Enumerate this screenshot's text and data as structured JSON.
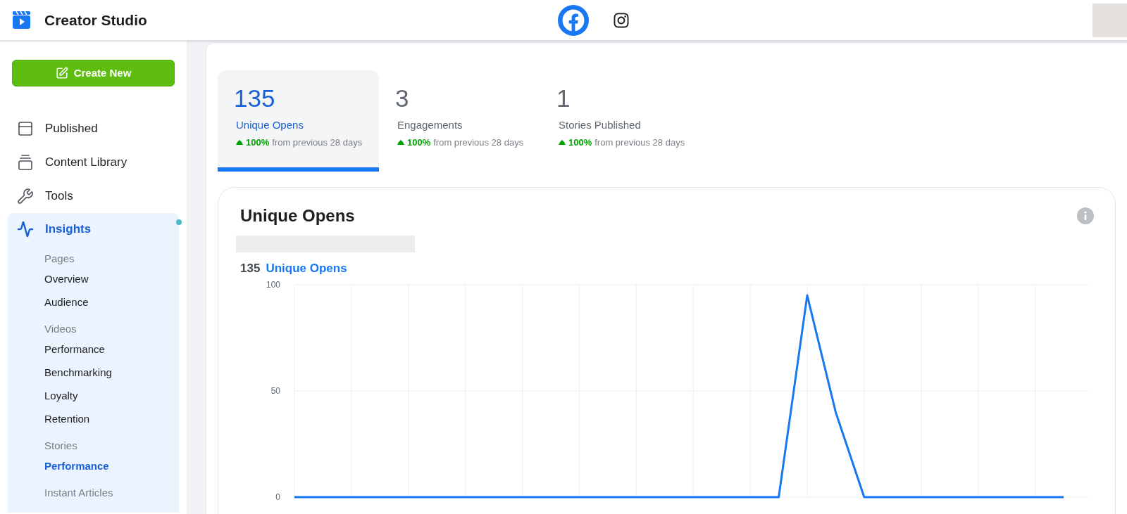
{
  "header": {
    "title": "Creator Studio",
    "platforms": [
      {
        "kind": "facebook",
        "selected": true
      },
      {
        "kind": "instagram",
        "selected": false
      }
    ]
  },
  "sidebar": {
    "create_button": "Create New",
    "items": [
      {
        "kind": "published",
        "label": "Published",
        "selected": false
      },
      {
        "kind": "library",
        "label": "Content Library",
        "selected": false
      },
      {
        "kind": "tools",
        "label": "Tools",
        "selected": false
      },
      {
        "kind": "insights",
        "label": "Insights",
        "selected": true,
        "dot": true,
        "sections": [
          {
            "heading": "Pages",
            "items": [
              {
                "label": "Overview",
                "selected": false
              },
              {
                "label": "Audience",
                "selected": false
              }
            ]
          },
          {
            "heading": "Videos",
            "items": [
              {
                "label": "Performance",
                "selected": false
              },
              {
                "label": "Benchmarking",
                "selected": false
              },
              {
                "label": "Loyalty",
                "selected": false
              },
              {
                "label": "Retention",
                "selected": false
              }
            ]
          },
          {
            "heading": "Stories",
            "items": [
              {
                "label": "Performance",
                "selected": true
              }
            ]
          },
          {
            "heading": "Instant Articles"
          }
        ]
      }
    ]
  },
  "metrics": [
    {
      "value": "135",
      "label": "Unique Opens",
      "rising": true,
      "change": "100%",
      "period": "from previous 28 days",
      "selected": true
    },
    {
      "value": "3",
      "label": "Engagements",
      "rising": true,
      "change": "100%",
      "period": "from previous 28 days",
      "selected": false
    },
    {
      "value": "1",
      "label": "Stories Published",
      "rising": true,
      "change": "100%",
      "period": "from previous 28 days",
      "selected": false
    }
  ],
  "chart_card": {
    "title": "Unique Opens",
    "total": "135",
    "total_label": "Unique Opens",
    "chart_data": {
      "type": "line",
      "grid": true,
      "ylim": [
        0,
        100
      ],
      "yticks": [
        0,
        50,
        100
      ],
      "series": [
        {
          "color": "#1877f2",
          "values": [
            0,
            0,
            0,
            0,
            0,
            0,
            0,
            0,
            0,
            0,
            0,
            0,
            0,
            0,
            0,
            0,
            0,
            0,
            95,
            40,
            0,
            0,
            0,
            0,
            0,
            0,
            0,
            0
          ]
        }
      ]
    }
  }
}
